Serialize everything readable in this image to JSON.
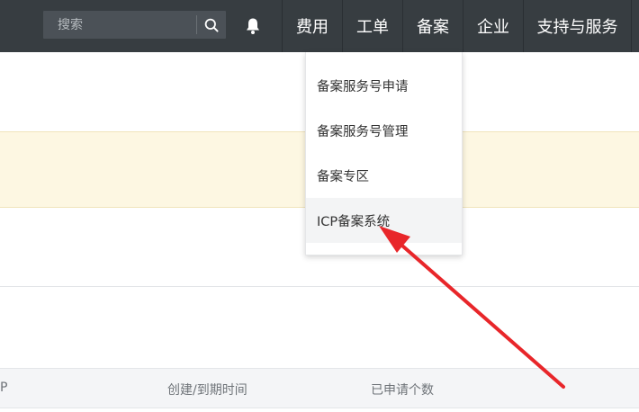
{
  "topbar": {
    "search": {
      "placeholder": "搜索",
      "icon": "search-icon"
    },
    "bell_icon": "bell-icon",
    "nav": [
      {
        "label": "费用"
      },
      {
        "label": "工单"
      },
      {
        "label": "备案"
      },
      {
        "label": "企业"
      },
      {
        "label": "支持与服务"
      }
    ]
  },
  "dropdown": {
    "items": [
      {
        "label": "备案服务号申请"
      },
      {
        "label": "备案服务号管理"
      },
      {
        "label": "备案专区"
      },
      {
        "label": "ICP备案系统"
      }
    ]
  },
  "table": {
    "headers": [
      "P",
      "创建/到期时间",
      "已申请个数"
    ]
  },
  "colors": {
    "topbar_bg": "#373d41",
    "banner_bg": "#fdf7e2",
    "arrow": "#e8262a",
    "hover_bg": "#f3f4f5"
  }
}
